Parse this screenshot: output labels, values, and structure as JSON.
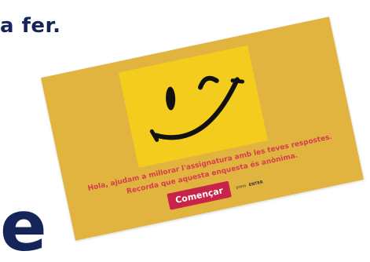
{
  "background": {
    "heading_fragment": "a fer.",
    "letter_fragment": "e"
  },
  "survey": {
    "card_color": "#e0b43f",
    "image": {
      "name": "winking-smiley-icon",
      "background_color": "#f4cc1d"
    },
    "intro_text": "Hola, ajudam a millorar l'assignatura amb les teves respostes. Recorda que aquesta enquesta és anònima.",
    "start_button": {
      "label": "Començar",
      "color": "#c8244a"
    },
    "enter_hint": {
      "text": "prem",
      "key": "ENTER"
    },
    "text_color": "#d63c4f"
  }
}
